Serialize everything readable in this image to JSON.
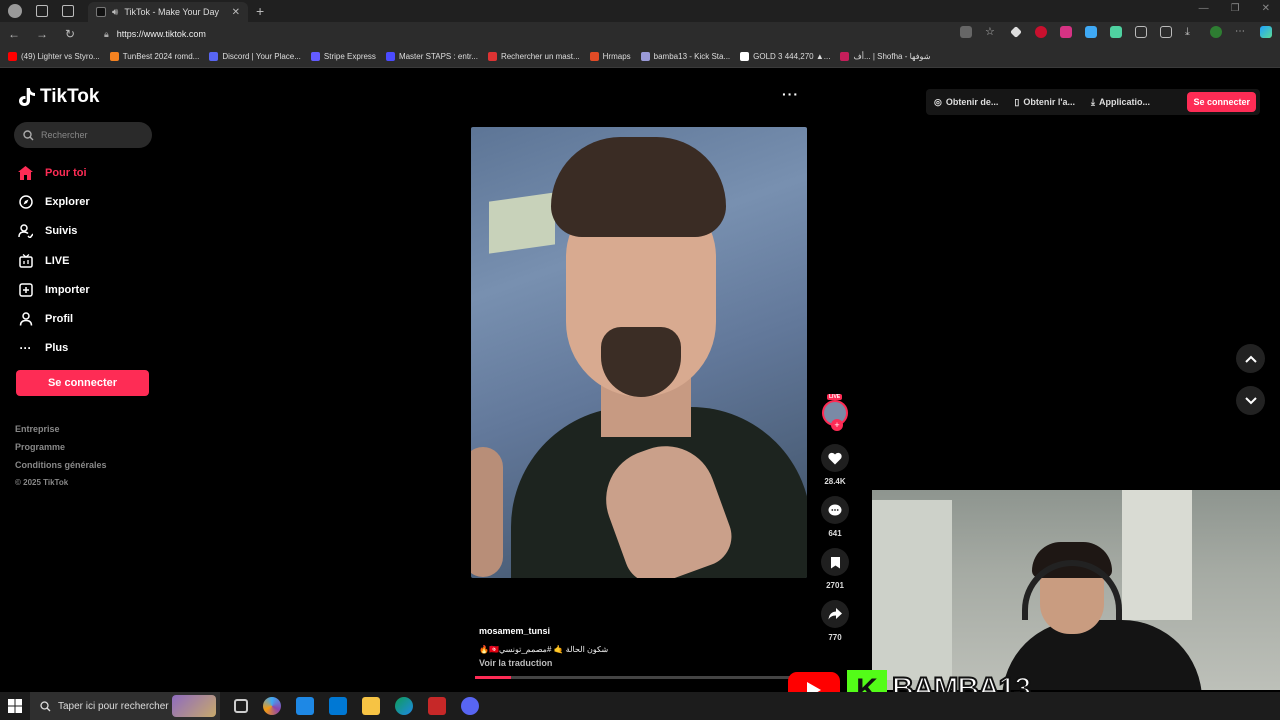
{
  "browser": {
    "tab_title": "TikTok - Make Your Day",
    "url": "https://www.tiktok.com",
    "bookmarks": [
      {
        "label": "(49) Lighter vs Styro...",
        "color": "#ff0000"
      },
      {
        "label": "TunBest 2024 romd...",
        "color": "#f58220"
      },
      {
        "label": "Discord | Your Place...",
        "color": "#5865f2"
      },
      {
        "label": "Stripe Express",
        "color": "#635bff"
      },
      {
        "label": "Master STAPS : entr...",
        "color": "#4b4bff"
      },
      {
        "label": "Rechercher un mast...",
        "color": "#d33"
      },
      {
        "label": "Hrmaps",
        "color": "#e24b26"
      },
      {
        "label": "bamba13 - Kick Sta...",
        "color": "#9a9ad8"
      },
      {
        "label": "GOLD 3 444,270 ▲...",
        "color": "#fff"
      },
      {
        "label": "أف... | Shofha - شوفها",
        "color": "#c41e5a"
      }
    ]
  },
  "sidebar": {
    "logo": "TikTok",
    "search_placeholder": "Rechercher",
    "items": [
      {
        "label": "Pour toi",
        "icon": "home-icon"
      },
      {
        "label": "Explorer",
        "icon": "compass-icon"
      },
      {
        "label": "Suivis",
        "icon": "following-icon"
      },
      {
        "label": "LIVE",
        "icon": "live-icon"
      },
      {
        "label": "Importer",
        "icon": "upload-icon"
      },
      {
        "label": "Profil",
        "icon": "profile-icon"
      },
      {
        "label": "Plus",
        "icon": "more-icon"
      }
    ],
    "login_button": "Se connecter",
    "footer": [
      "Entreprise",
      "Programme",
      "Conditions générales"
    ],
    "copyright": "© 2025 TikTok"
  },
  "top_bar": {
    "item1": "Obtenir de...",
    "item2": "Obtenir l'a...",
    "item3": "Applicatio...",
    "login": "Se connecter"
  },
  "video": {
    "username": "mosamem_tunsi",
    "caption": "شكون الحالة 🤙 #مصمم_تونسي🇹🇳🔥",
    "translate": "Voir la traduction",
    "progress": 0.11,
    "live_label": "LIVE",
    "likes": "28.4K",
    "comments": "641",
    "saves": "2701",
    "shares": "770"
  },
  "overlay": {
    "streamer": "BAMBA13"
  },
  "taskbar": {
    "search_placeholder": "Taper ici pour rechercher"
  },
  "colors": {
    "accent": "#fe2c55",
    "background": "#000000"
  }
}
